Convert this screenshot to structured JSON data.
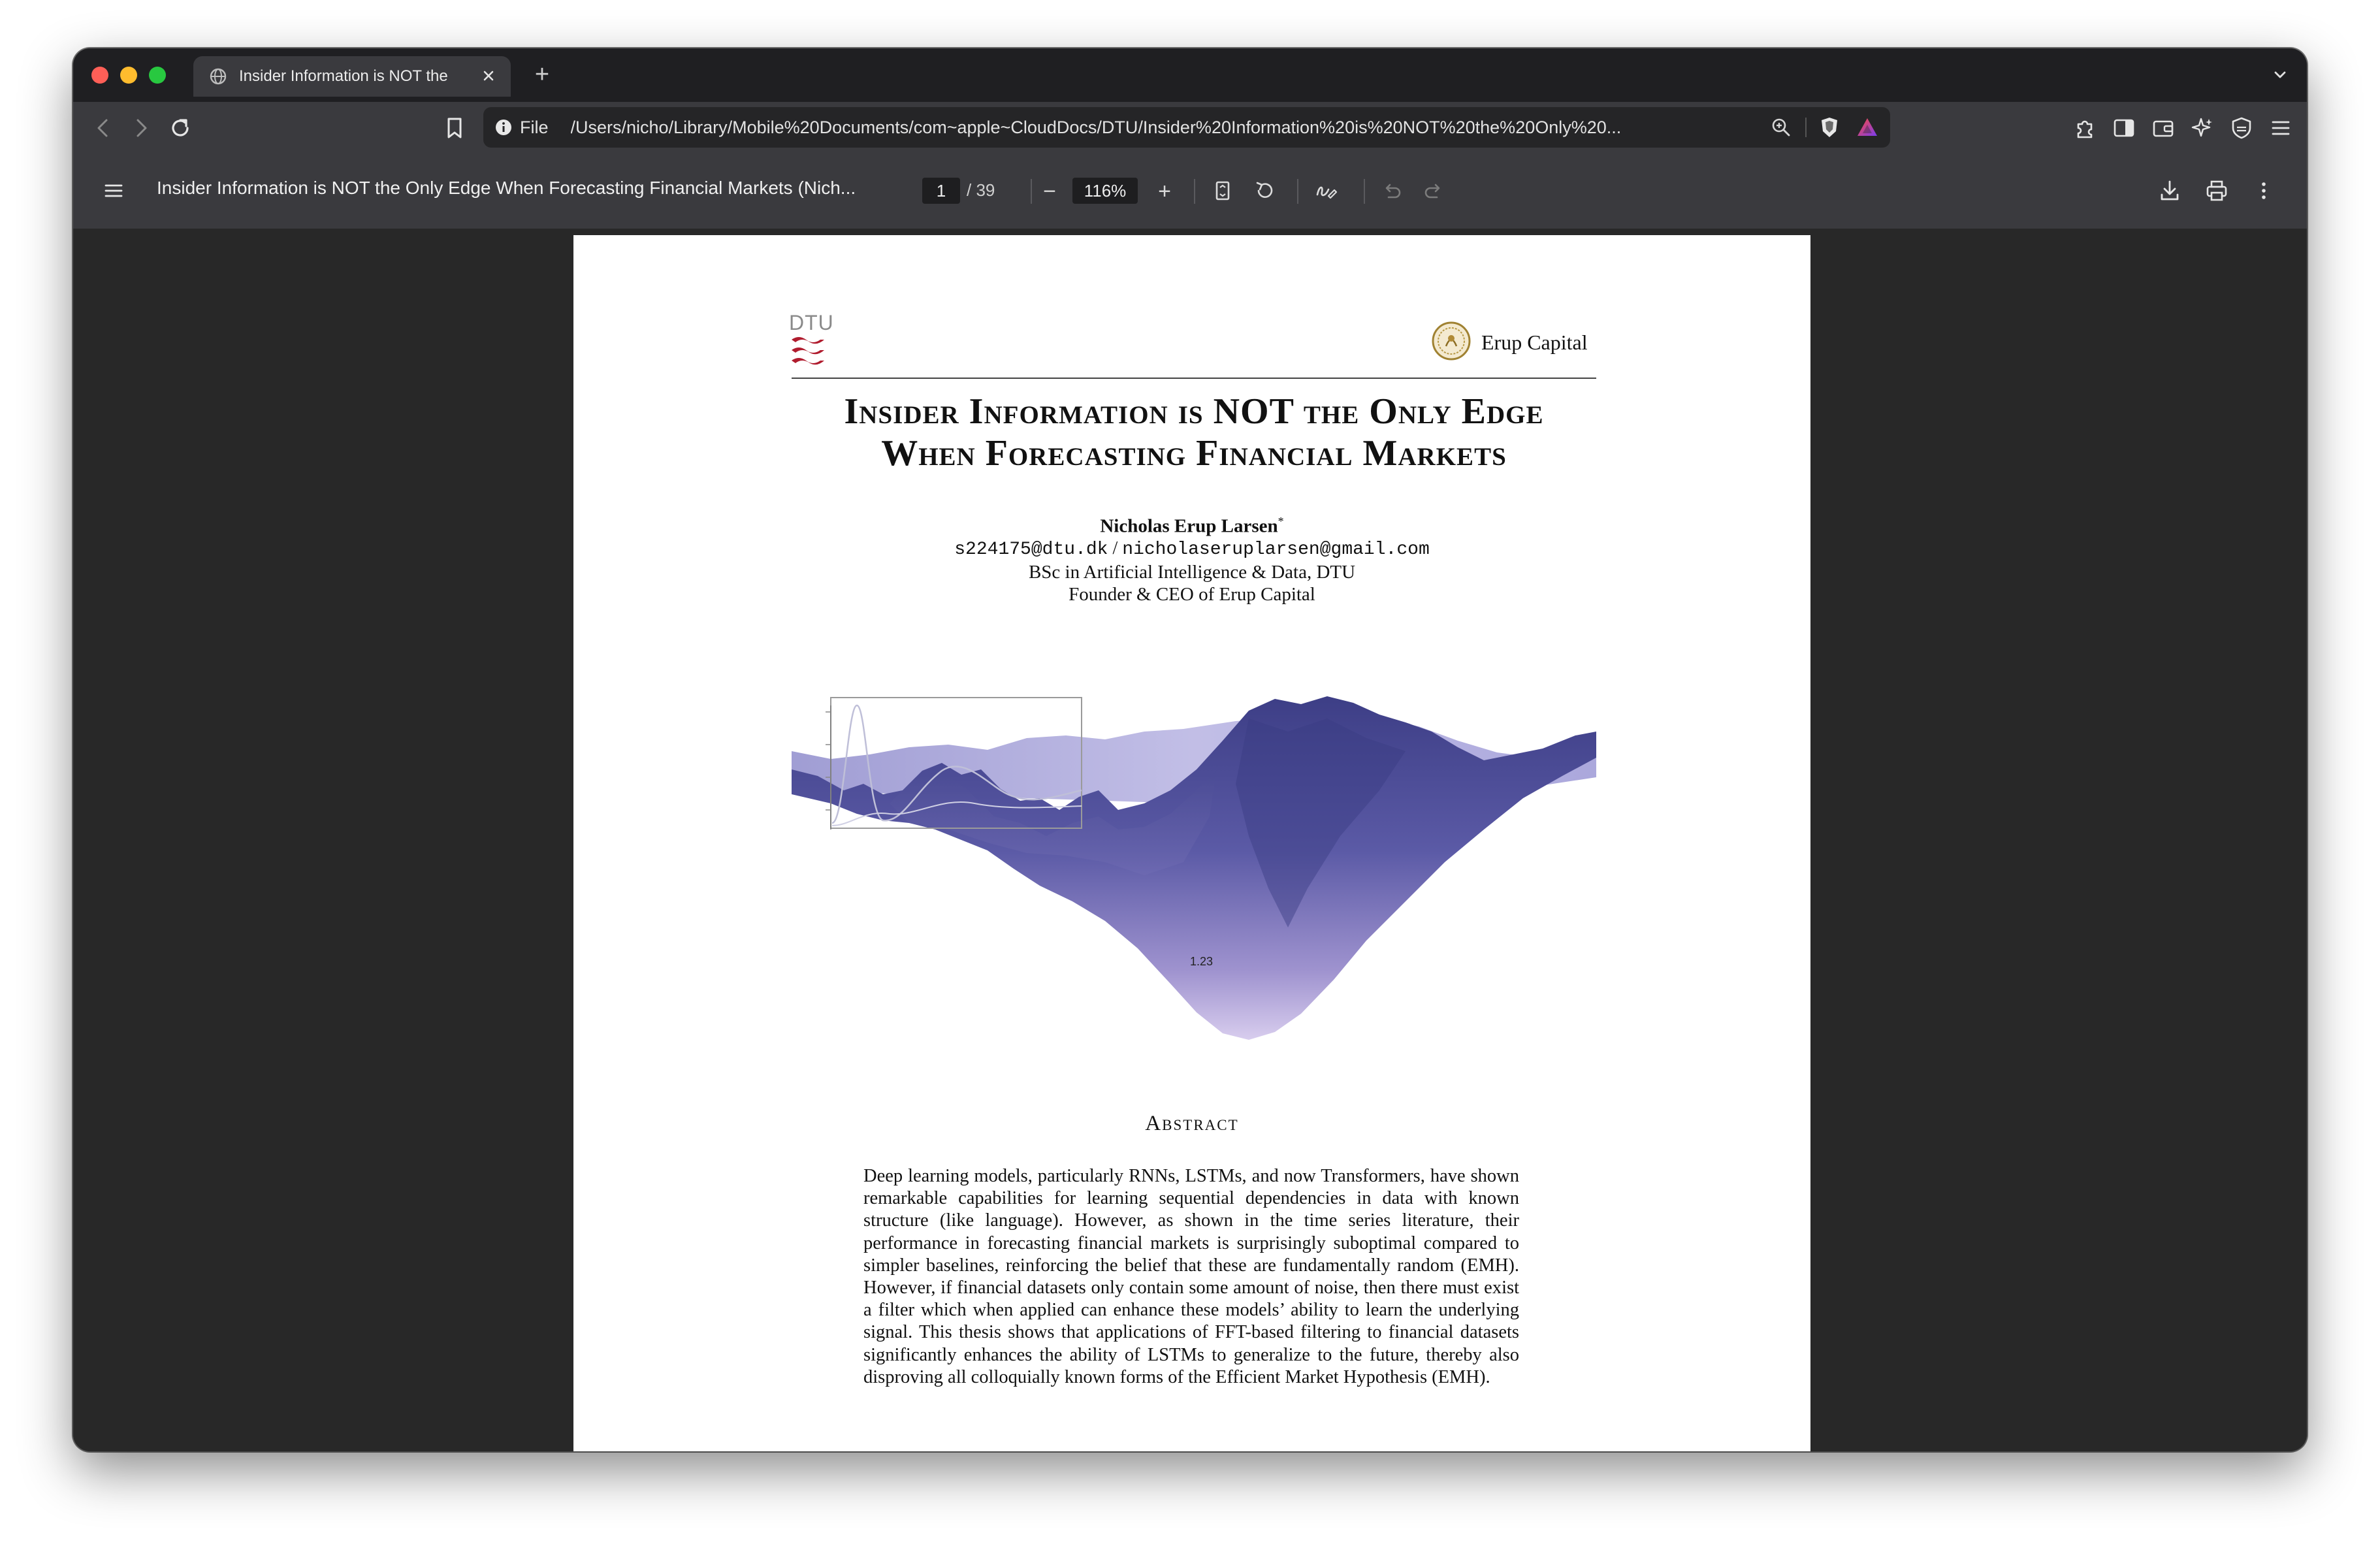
{
  "browser": {
    "tab": {
      "title": "Insider Information is NOT the",
      "favicon": "globe-icon"
    },
    "new_tab_symbol": "+",
    "address": {
      "scheme_label": "File",
      "url": "/Users/nicho/Library/Mobile%20Documents/com~apple~CloudDocs/DTU/Insider%20Information%20is%20NOT%20the%20Only%20..."
    },
    "accent_colors": {
      "close": "#ff5f57",
      "minimize": "#febc2e",
      "zoom": "#28c840"
    }
  },
  "pdf_toolbar": {
    "title": "Insider Information is NOT the Only Edge When Forecasting Financial Markets (Nich...",
    "page_current": "1",
    "page_total": "/ 39",
    "zoom": "116%",
    "zoom_out_symbol": "−",
    "zoom_in_symbol": "+"
  },
  "document": {
    "logo_left": "DTU",
    "logo_right": "Erup Capital",
    "title_line1": "Insider Information is NOT the Only Edge",
    "title_line2": "When Forecasting Financial Markets",
    "author": "Nicholas Erup Larsen",
    "author_mark": "*",
    "email1": "s224175@dtu.dk",
    "email_sep": " / ",
    "email2": "nicholaseruplarsen@gmail.com",
    "affiliation": "BSc in Artificial Intelligence & Data, DTU",
    "role": "Founder & CEO of Erup Capital",
    "figure_label": "1.23",
    "abstract_heading": "Abstract",
    "abstract_text": "Deep learning models, particularly RNNs, LSTMs, and now Transformers, have shown remarkable capabilities for learning sequential dependencies in data with known structure (like language). However, as shown in the time series literature, their performance in forecasting financial markets is surprisingly suboptimal compared to simpler baselines, reinforcing the belief that these are fundamentally random (EMH). However, if financial datasets only contain some amount of noise, then there must exist a filter which when applied can enhance these models’ ability to learn the underlying signal. This thesis shows that applications of FFT-based filtering to financial datasets significantly enhances the ability of LSTMs to generalize to the future, thereby also disproving all colloquially known forms of the Efficient Market Hypothesis (EMH)."
  }
}
